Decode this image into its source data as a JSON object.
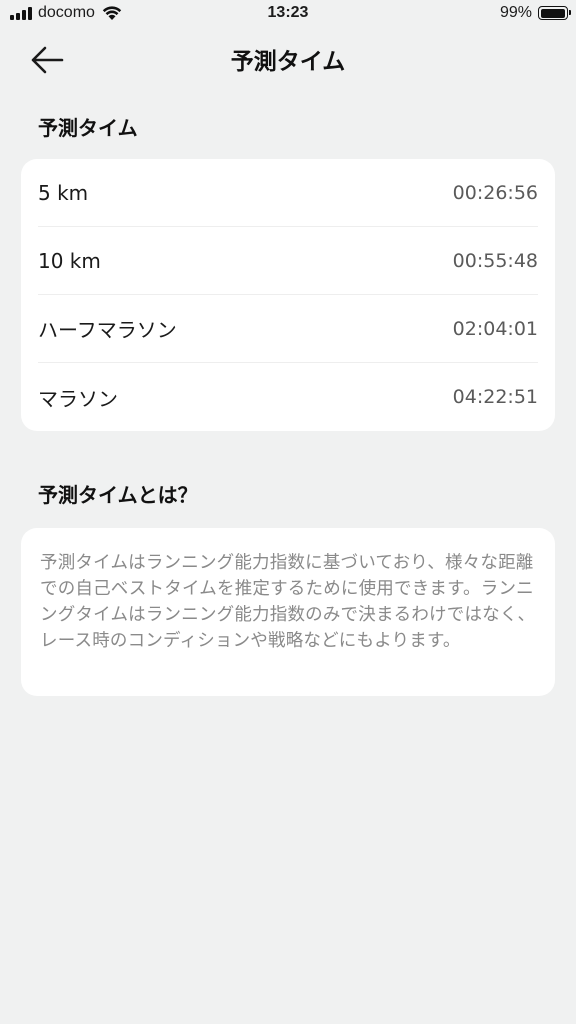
{
  "status_bar": {
    "carrier": "docomo",
    "time": "13:23",
    "battery": "99%",
    "battery_level": 0.99
  },
  "header": {
    "title": "予測タイム",
    "back_icon": "arrow-left-icon"
  },
  "predictions": {
    "section_title": "予測タイム",
    "rows": [
      {
        "label": "5 km",
        "value": "00:26:56"
      },
      {
        "label": "10 km",
        "value": "00:55:48"
      },
      {
        "label": "ハーフマラソン",
        "value": "02:04:01"
      },
      {
        "label": "マラソン",
        "value": "04:22:51"
      }
    ]
  },
  "about": {
    "section_title": "予測タイムとは？",
    "description": "予測タイムはランニング能力指数に基づいており、様々な距離での自己ベストタイムを推定するために使用できます。ランニングタイムはランニング能力指数のみで決まるわけではなく、レース時のコンディションや戦略などにもよります。"
  },
  "colors": {
    "background": "#f0f1f1",
    "card": "#ffffff",
    "secondary_text": "#8a8a8a"
  }
}
